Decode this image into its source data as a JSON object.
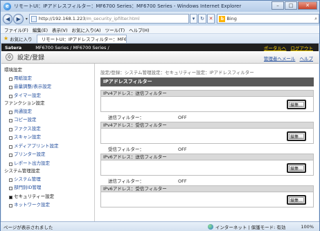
{
  "window": {
    "title": "リモートUI：IPアドレスフィルター：MF6700 Series：MF6700 Series - Windows Internet Explorer",
    "minimize": "–",
    "maximize": "□",
    "close": "✕"
  },
  "addressbar": {
    "back": "◀",
    "forward": "▶",
    "url_host": "http://192.168.1.223",
    "url_path": "/m_security_ipfilter.html",
    "refresh": "↻",
    "stop": "✕",
    "search_provider": "Bing",
    "search_icon": "search-icon"
  },
  "menu": [
    "ファイル(F)",
    "編集(E)",
    "表示(V)",
    "お気に入り(A)",
    "ツール(T)",
    "ヘルプ(H)"
  ],
  "favorites": {
    "label": "お気に入り",
    "tab_title": "リモートUI：IPアドレスフィルター：MF6700 ..."
  },
  "header": {
    "brand": "Satera",
    "model": "MF6700 Series / MF6700 Series /",
    "link_portal": "ポータルへ",
    "link_logout": "ログアウト",
    "page_title": "設定/登録",
    "link_admin_mail": "管理者へメール",
    "link_help": "ヘルプ"
  },
  "sidebar": {
    "sections": [
      {
        "label": "環境設定",
        "items": [
          {
            "label": "用紙設定",
            "selected": false
          },
          {
            "label": "音量調整/表示設定",
            "selected": false
          },
          {
            "label": "タイマー設定",
            "selected": false
          }
        ]
      },
      {
        "label": "ファンクション設定",
        "items": [
          {
            "label": "共通設定",
            "selected": false
          },
          {
            "label": "コピー設定",
            "selected": false
          },
          {
            "label": "ファクス設定",
            "selected": false
          },
          {
            "label": "スキャン設定",
            "selected": false
          },
          {
            "label": "メディアプリント設定",
            "selected": false
          },
          {
            "label": "プリンター設定",
            "selected": false
          },
          {
            "label": "レポート出力設定",
            "selected": false
          }
        ]
      },
      {
        "label": "システム管理設定",
        "items": [
          {
            "label": "システム管理",
            "selected": false
          },
          {
            "label": "部門別ID管理",
            "selected": false
          },
          {
            "label": "セキュリティー設定",
            "selected": true
          },
          {
            "label": "ネットワーク設定",
            "selected": false
          }
        ]
      }
    ]
  },
  "main": {
    "breadcrumb": "設定/登録：システム管理設定：セキュリティー設定：IPアドレスフィルター",
    "title": "IPアドレスフィルター",
    "sections": [
      {
        "heading": "IPv4アドレス：送信フィルター",
        "edit_label": "編集...",
        "status_key": "送信フィルター：",
        "status_value": "OFF"
      },
      {
        "heading": "IPv4アドレス：受信フィルター",
        "edit_label": "編集...",
        "status_key": "受信フィルター：",
        "status_value": "OFF"
      },
      {
        "heading": "IPv6アドレス：送信フィルター",
        "edit_label": "編集...",
        "status_key": "送信フィルター：",
        "status_value": "OFF"
      },
      {
        "heading": "IPv6アドレス：受信フィルター",
        "edit_label": "編集...",
        "status_key": "",
        "status_value": ""
      }
    ]
  },
  "statusbar": {
    "left": "ページが表示されました",
    "zone": "インターネット | 保護モード: 有効",
    "zoom": "100%"
  }
}
